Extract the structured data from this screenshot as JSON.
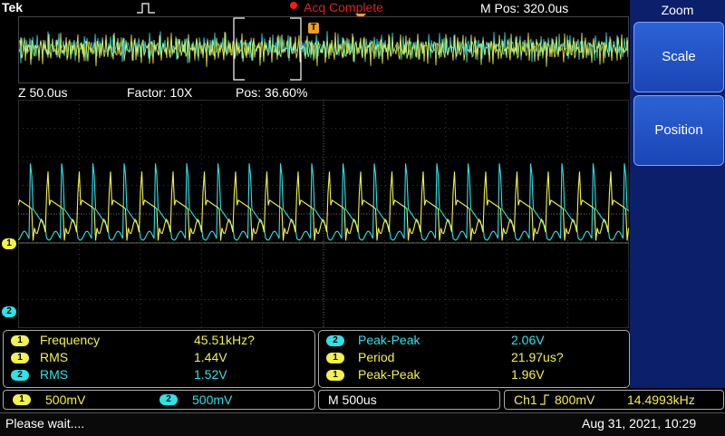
{
  "header": {
    "brand": "Tek",
    "acquisition_status": "Acq Complete",
    "m_pos": "M Pos: 320.0us"
  },
  "zoom_info": {
    "z_scale": "Z 50.0us",
    "factor": "Factor: 10X",
    "pos": "Pos: 36.60%"
  },
  "side_menu": {
    "title": "Zoom",
    "buttons": [
      "Scale",
      "Position"
    ]
  },
  "channel_markers": {
    "ch1": "1",
    "ch2": "2",
    "overview_tag": "T"
  },
  "measurements_left": [
    {
      "ch": "1",
      "name": "Frequency",
      "value": "45.51kHz?"
    },
    {
      "ch": "1",
      "name": "RMS",
      "value": "1.44V"
    },
    {
      "ch": "2",
      "name": "RMS",
      "value": "1.52V"
    }
  ],
  "measurements_right": [
    {
      "ch": "2",
      "name": "Peak-Peak",
      "value": "2.06V"
    },
    {
      "ch": "1",
      "name": "Period",
      "value": "21.97us?"
    },
    {
      "ch": "1",
      "name": "Peak-Peak",
      "value": "1.96V"
    }
  ],
  "status_row": {
    "ch1_label": "1",
    "ch1_scale": "500mV",
    "ch2_label": "2",
    "ch2_scale": "500mV",
    "timebase": "M 500us",
    "trigger_source": "Ch1",
    "trigger_level": "800mV",
    "trigger_freq": "14.4993kHz"
  },
  "footer": {
    "message": "Please wait....",
    "datetime": "Aug 31, 2021, 10:29"
  },
  "colors": {
    "ch1": "#f2f24a",
    "ch2": "#2ee2e8",
    "accent_red": "#ff1a1a",
    "menu_blue": "#1b45b5"
  }
}
